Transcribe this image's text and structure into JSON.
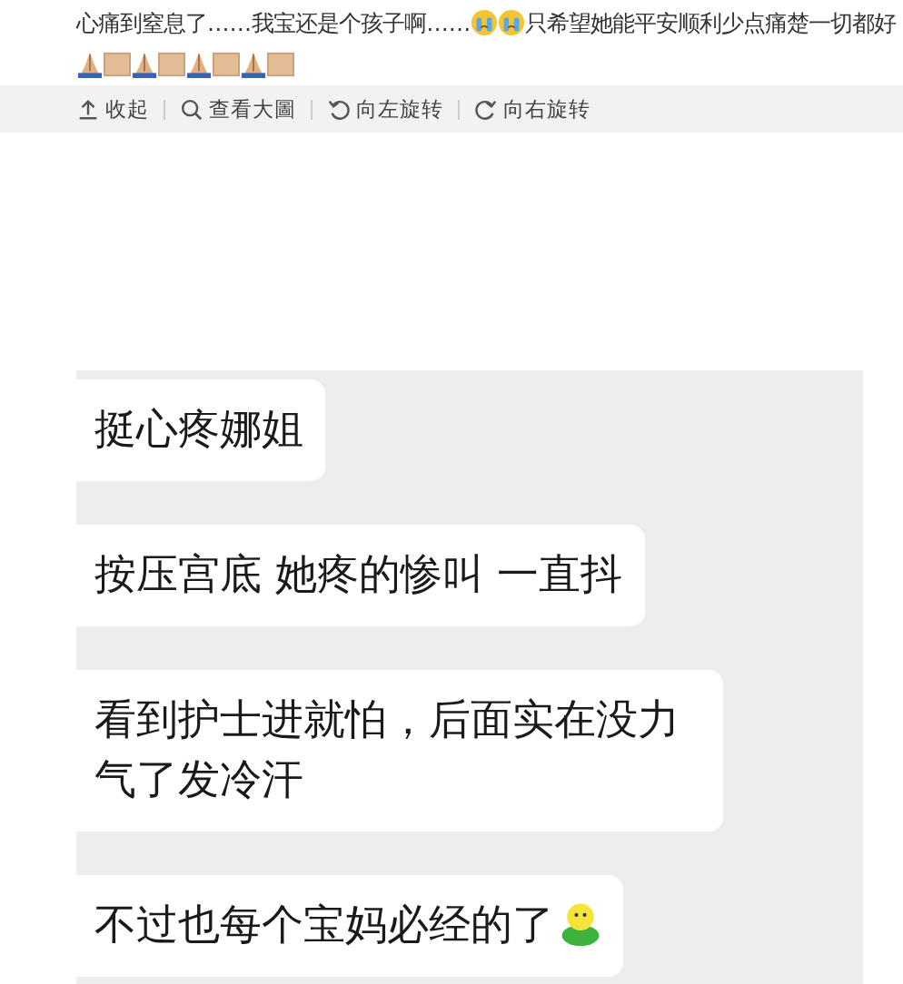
{
  "post": {
    "segments": [
      {
        "kind": "text",
        "text": "心痛到窒息了……我宝还是个孩子啊……"
      },
      {
        "kind": "crying-emoji"
      },
      {
        "kind": "crying-emoji"
      },
      {
        "kind": "text",
        "text": "只希望她能平安顺利少点痛楚一切都好"
      },
      {
        "kind": "pray-emoji"
      },
      {
        "kind": "missing-glyph"
      },
      {
        "kind": "pray-emoji"
      },
      {
        "kind": "missing-glyph"
      },
      {
        "kind": "pray-emoji"
      },
      {
        "kind": "missing-glyph"
      },
      {
        "kind": "pray-emoji"
      },
      {
        "kind": "missing-glyph"
      }
    ]
  },
  "toolbar": [
    {
      "kind": "collapse",
      "label": "收起"
    },
    {
      "kind": "zoom",
      "label": "查看大圖"
    },
    {
      "kind": "rotate-left",
      "label": "向左旋转"
    },
    {
      "kind": "rotate-right",
      "label": "向右旋转"
    }
  ],
  "chat": [
    {
      "kind": "text",
      "text": "挺心疼娜姐"
    },
    {
      "kind": "text",
      "text": "按压宫底 她疼的惨叫 一直抖"
    },
    {
      "kind": "text",
      "text": "看到护士进就怕，后面实在没力气了发冷汗"
    },
    {
      "kind": "text-with-emoji",
      "text": "不过也每个宝妈必经的了"
    }
  ]
}
